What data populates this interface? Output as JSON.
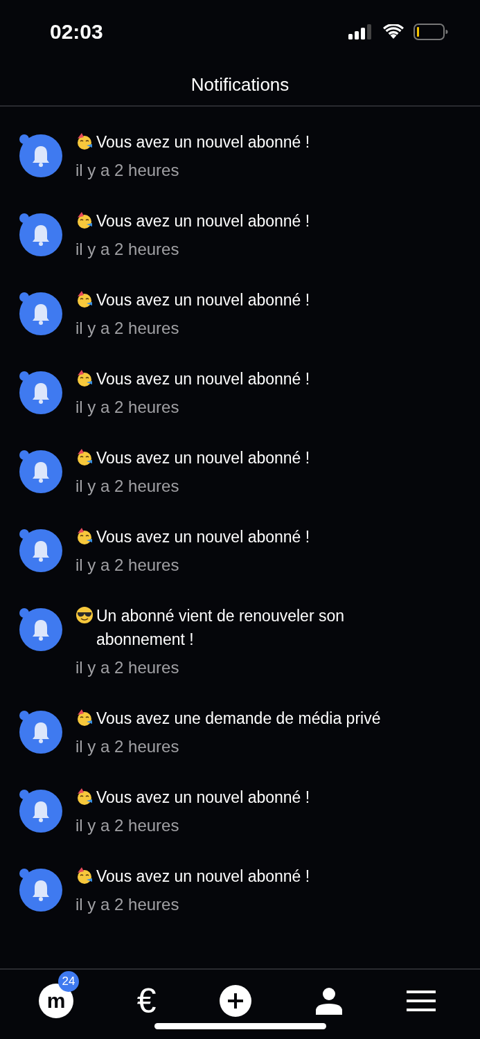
{
  "status_bar": {
    "time": "02:03"
  },
  "header": {
    "title": "Notifications"
  },
  "notifications": [
    {
      "kind": "party",
      "title": "Vous avez un nouvel abonné !",
      "time": "il y a 2 heures",
      "unread": true
    },
    {
      "kind": "party",
      "title": "Vous avez un nouvel abonné !",
      "time": "il y a 2 heures",
      "unread": true
    },
    {
      "kind": "party",
      "title": "Vous avez un nouvel abonné !",
      "time": "il y a 2 heures",
      "unread": true
    },
    {
      "kind": "party",
      "title": "Vous avez un nouvel abonné !",
      "time": "il y a 2 heures",
      "unread": true
    },
    {
      "kind": "party",
      "title": "Vous avez un nouvel abonné !",
      "time": "il y a 2 heures",
      "unread": true
    },
    {
      "kind": "party",
      "title": "Vous avez un nouvel abonné !",
      "time": "il y a 2 heures",
      "unread": true
    },
    {
      "kind": "cool",
      "title": "Un abonné vient de renouveler son abonnement !",
      "time": "il y a 2 heures",
      "unread": true
    },
    {
      "kind": "party",
      "title": "Vous avez une demande de média privé",
      "time": "il y a 2 heures",
      "unread": true
    },
    {
      "kind": "party",
      "title": "Vous avez un nouvel abonné !",
      "time": "il y a 2 heures",
      "unread": true
    },
    {
      "kind": "party",
      "title": "Vous avez un nouvel abonné !",
      "time": "il y a 2 heures",
      "unread": true
    }
  ],
  "tab_bar": {
    "logo_letter": "m",
    "badge": "24",
    "currency": "€"
  }
}
